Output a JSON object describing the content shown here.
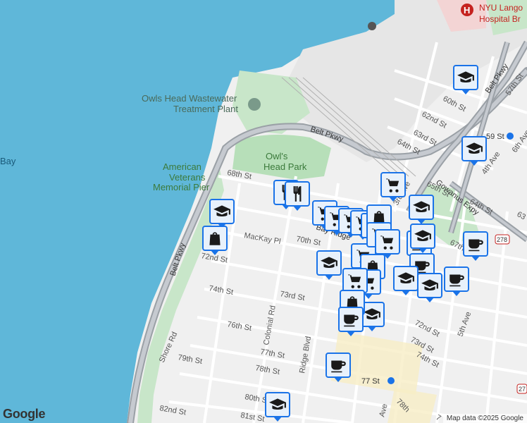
{
  "map": {
    "labels": {
      "hospital": "NYU Langone Hospital Brooklyn",
      "hospital_line1": "NYU Lango",
      "hospital_line2": "Hospital Br",
      "treatment_line1": "Owls Head Wastewater",
      "treatment_line2": "Treatment Plant",
      "park_line1": "Owl's",
      "park_line2": "Head Park",
      "pier_line1": "American",
      "pier_line2": "Veterans",
      "pier_line3": "Memorial Pier",
      "bay": "Bay",
      "belt_pkwy_top": "Belt Pkwy",
      "belt_pkwy_side": "Belt Pkwy",
      "belt_pkwy_ne": "Belt Pkwy",
      "gowanus": "Gowanus Expy",
      "bay_ridge_pkwy": "Bay Ridge",
      "subway_59": "59 St",
      "subway_77": "77 St",
      "shield_278_a": "278",
      "shield_278_b": "27"
    },
    "streets": [
      "57th St",
      "60th St",
      "62nd St",
      "63rd St",
      "64th St",
      "65th St",
      "6th Ave",
      "4th Ave",
      "3rd Ave",
      "5th Ave",
      "64th St",
      "63",
      "67th",
      "68th St",
      "70th St",
      "72nd St",
      "73rd St",
      "74th St",
      "76th St",
      "77th St",
      "78th St",
      "79th St",
      "80th St",
      "81st St",
      "82nd St",
      "Colonial Rd",
      "Ridge Blvd",
      "Shore Rd",
      "MacKay Pl",
      "72nd St",
      "73rd St",
      "74th St",
      "Ave",
      "78th",
      "7"
    ],
    "poi_icons": [
      "restaurant-icon",
      "grocery-icon",
      "school-icon",
      "shopping-icon",
      "cafe-icon"
    ]
  },
  "attribution": {
    "logo": "Google",
    "copyright": "Map data ©2025 Google"
  }
}
